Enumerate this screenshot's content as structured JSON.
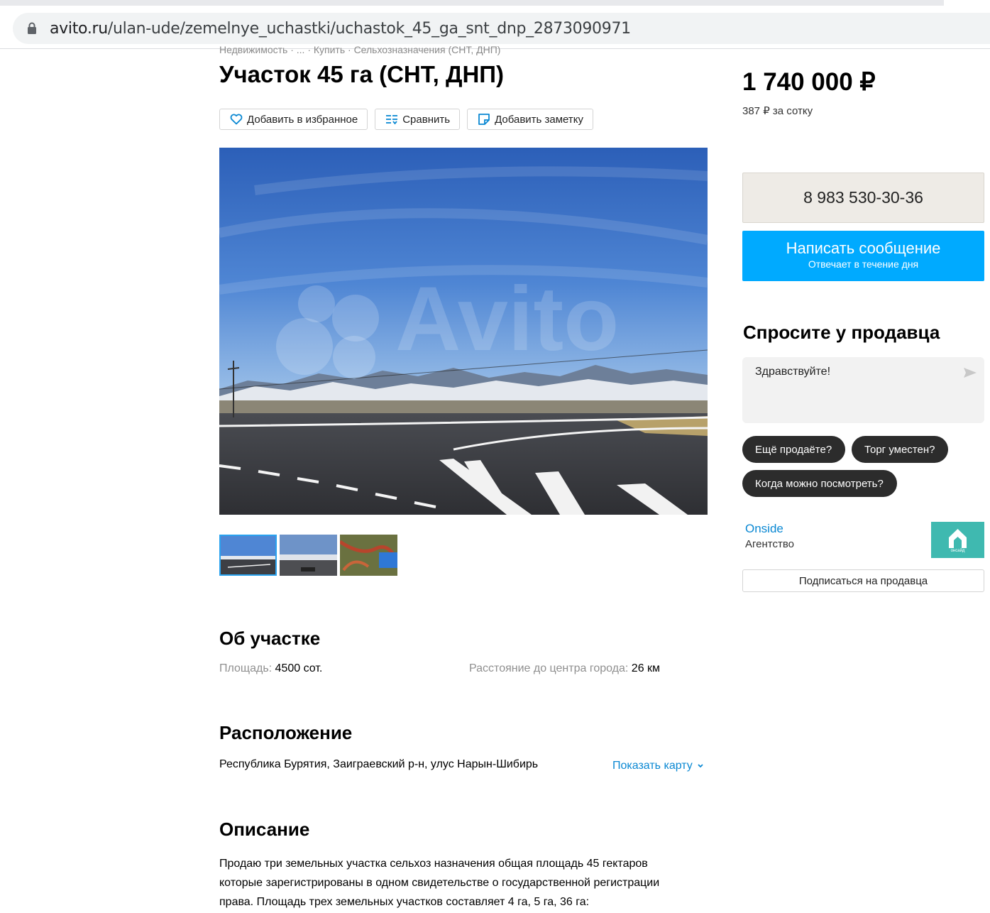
{
  "browser": {
    "url_domain": "avito.ru",
    "url_path": "/ulan-ude/zemelnye_uchastki/uchastok_45_ga_snt_dnp_2873090971"
  },
  "listing": {
    "breadcrumbs": "Недвижимость · ... · Купить · Сельхозназначения (СНТ, ДНП)",
    "title": "Участок 45 га (СНТ, ДНП)",
    "actions": {
      "favorite": "Добавить в избранное",
      "compare": "Сравнить",
      "note": "Добавить заметку"
    },
    "watermark": "Avito",
    "gallery_count": 3
  },
  "about": {
    "title": "Об участке",
    "area_label": "Площадь:",
    "area_value": "4500 сот.",
    "distance_label": "Расстояние до центра города:",
    "distance_value": "26 км"
  },
  "location": {
    "title": "Расположение",
    "address": "Республика Бурятия, Заиграевский р-н, улус Нарын-Шибирь",
    "show_map": "Показать карту"
  },
  "description": {
    "title": "Описание",
    "lines": [
      "Продаю три земельных участка сельхоз назначения общая площадь 45 гектаров",
      "которые зарегистрированы в одном свидетельстве о государственной регистрации",
      "права. Площадь трех земельных участков составляет 4 га, 5 га, 36 га:"
    ]
  },
  "sidebar": {
    "price": "1 740 000 ₽",
    "price_per": "387 ₽ за сотку",
    "phone": "8 983 530-30-36",
    "message_button": "Написать сообщение",
    "message_sub": "Отвечает в течение дня",
    "ask_title": "Спросите у продавца",
    "ask_placeholder": "Здравствуйте!",
    "chips": [
      "Ещё продаёте?",
      "Торг уместен?",
      "Когда можно посмотреть?"
    ],
    "seller_name": "Onside",
    "seller_type": "Агентство",
    "seller_logo_text": "онсайд",
    "subscribe": "Подписаться на продавца"
  },
  "colors": {
    "accent_blue": "#00aaff",
    "link_blue": "#0a88d3",
    "chip_dark": "#2c2c2c",
    "phone_bg": "#eeebe6",
    "seller_logo": "#3fb9b0"
  },
  "icons": [
    "lock-icon",
    "heart-icon",
    "compare-icon",
    "note-icon",
    "chevron-down-icon",
    "send-icon",
    "house-logo-icon"
  ]
}
